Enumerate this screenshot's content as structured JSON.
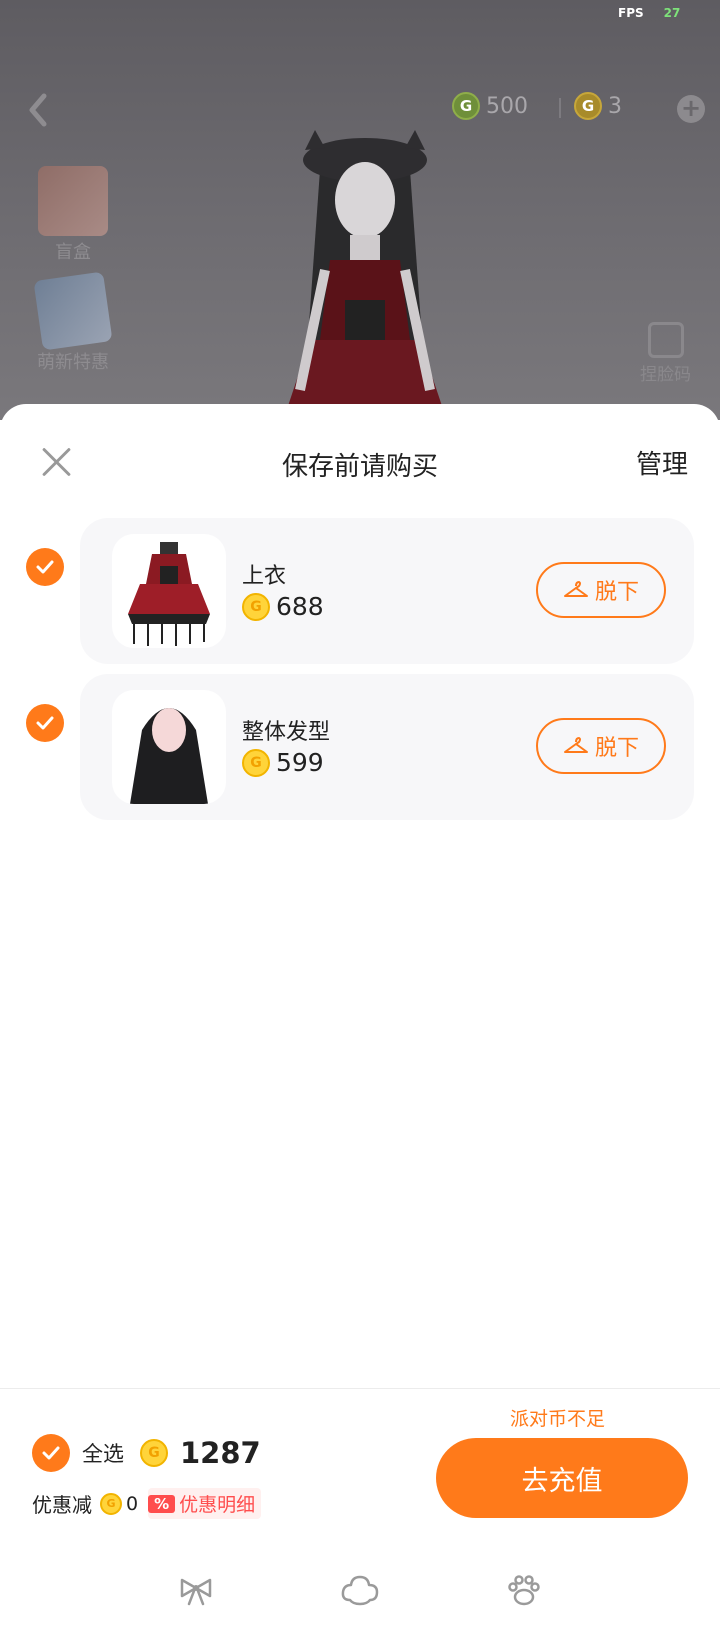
{
  "scene": {
    "fps_label": "FPS",
    "fps_value": "27",
    "green_coin_amount": "500",
    "gold_coin_amount": "3",
    "coin_glyph": "G",
    "side_items": [
      {
        "label": "盲盒",
        "icon": "gift-box-icon"
      },
      {
        "label": "萌新特惠",
        "icon": "gift-pack-icon"
      }
    ],
    "face_code_label": "捏脸码"
  },
  "sheet": {
    "title": "保存前请购买",
    "manage_label": "管理",
    "items": [
      {
        "name": "上衣",
        "price": "688",
        "remove_label": "脱下",
        "checked": true
      },
      {
        "name": "整体发型",
        "price": "599",
        "remove_label": "脱下",
        "checked": true
      }
    ]
  },
  "footer": {
    "insufficient_text": "派对币不足",
    "select_all_label": "全选",
    "total_price": "1287",
    "discount_label": "优惠减",
    "discount_value": "0",
    "discount_badge": "%",
    "discount_detail_label": "优惠明细",
    "recharge_label": "去充值"
  },
  "tabbar": {
    "tabs": [
      {
        "icon": "bow-icon"
      },
      {
        "icon": "cloud-icon"
      },
      {
        "icon": "paw-icon"
      }
    ]
  },
  "colors": {
    "accent": "#ff7a1a",
    "coin_gold": "#ffd43a",
    "discount_red": "#ff4d4d"
  }
}
